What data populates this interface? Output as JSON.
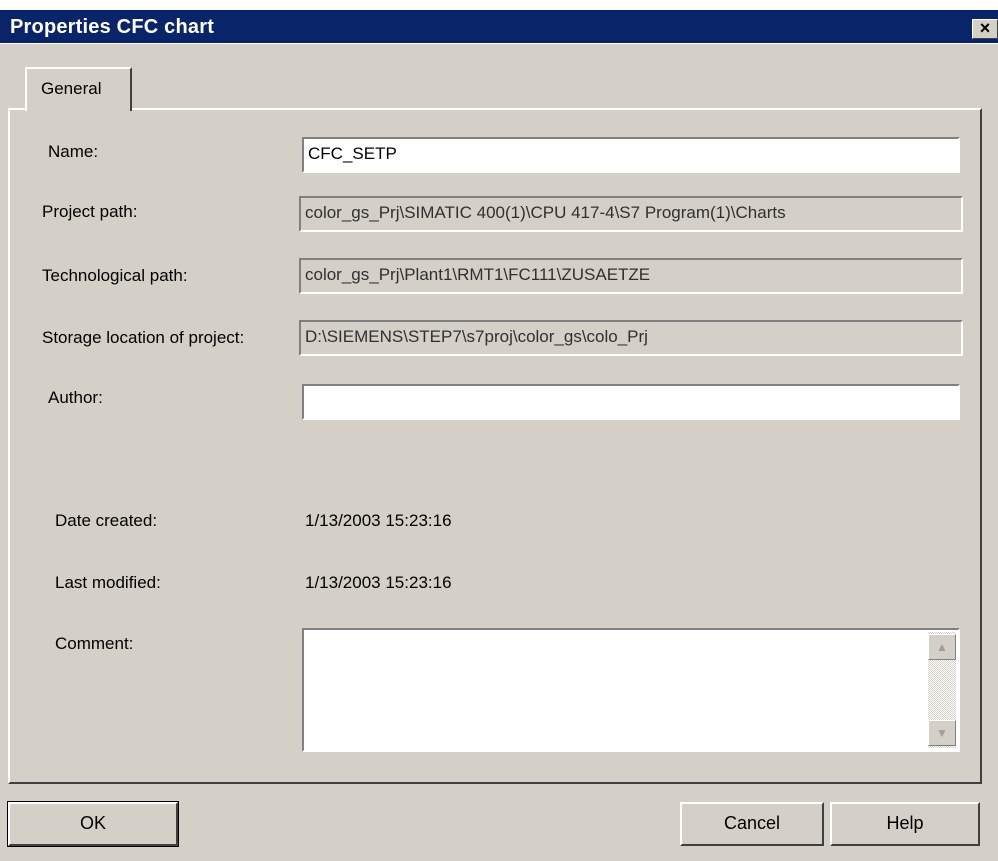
{
  "window": {
    "title": "Properties CFC chart",
    "close_glyph": "×"
  },
  "tabs": [
    {
      "label": "General"
    }
  ],
  "fields": {
    "name": {
      "label": "Name:",
      "value": "CFC_SETP"
    },
    "project_path": {
      "label": "Project path:",
      "value": "color_gs_Prj\\SIMATIC 400(1)\\CPU 417-4\\S7 Program(1)\\Charts"
    },
    "tech_path": {
      "label": "Technological path:",
      "value": "color_gs_Prj\\Plant1\\RMT1\\FC111\\ZUSAETZE"
    },
    "storage": {
      "label": "Storage location of project:",
      "value": "D:\\SIEMENS\\STEP7\\s7proj\\color_gs\\colo_Prj"
    },
    "author": {
      "label": "Author:",
      "value": ""
    },
    "date_created": {
      "label": "Date created:",
      "value": "1/13/2003 15:23:16"
    },
    "last_modified": {
      "label": "Last modified:",
      "value": "1/13/2003 15:23:16"
    },
    "comment": {
      "label": "Comment:",
      "value": ""
    }
  },
  "buttons": {
    "ok": "OK",
    "cancel": "Cancel",
    "help": "Help"
  },
  "icons": {
    "scroll_up": "scroll-up-arrow-icon",
    "scroll_down": "scroll-down-arrow-icon"
  }
}
